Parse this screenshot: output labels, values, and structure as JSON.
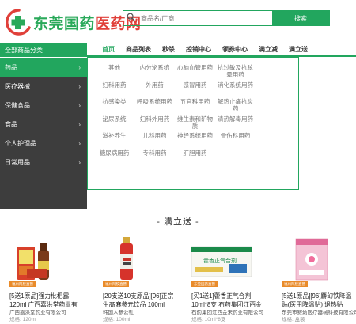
{
  "logo": {
    "part1": "东莞国药",
    "part2": "医药网",
    "colors": {
      "green": "#2aa95a",
      "red": "#e0403a"
    }
  },
  "search": {
    "placeholder": "商品名/厂商",
    "button": "搜索"
  },
  "navbar": {
    "all_categories": "全部商品分类",
    "items": [
      "首页",
      "商品列表",
      "秒杀",
      "控销中心",
      "领券中心",
      "满立减",
      "满立送"
    ]
  },
  "sidebar": {
    "items": [
      {
        "label": "药品",
        "arrow": "›"
      },
      {
        "label": "医疗器械",
        "arrow": "›"
      },
      {
        "label": "保健食品",
        "arrow": "›"
      },
      {
        "label": "食品",
        "arrow": "›"
      },
      {
        "label": "个人护理品",
        "arrow": "›"
      },
      {
        "label": "日常用品",
        "arrow": "›"
      }
    ]
  },
  "panel": {
    "cells": [
      "其他",
      "内分泌系统",
      "心脑血管用药",
      "抗过敏及抗眩晕用药",
      "",
      "妇科用药",
      "外用药",
      "感冒用药",
      "消化系统用药",
      "",
      "抗感染类",
      "呼吸系统用药",
      "五官科用药",
      "解热止痛抗炎药",
      "",
      "泌尿系统",
      "妇科外用药",
      "维生素和矿物质",
      "清热解毒用药",
      "",
      "滋补养生",
      "儿科用药",
      "神经系统用药",
      "骨伤科用药",
      "",
      "糖尿病用药",
      "专科用药",
      "肝胆用药",
      "",
      ""
    ]
  },
  "section": {
    "title": "- 满立送 -"
  },
  "products": [
    {
      "tag": "福州阿胶直营",
      "title": "[5送1原品]强力枇杷露 120ml 广西嘉洪堂药业有",
      "sub": "广西嘉洪堂药业有限公司",
      "sub2": "规格: 120ml"
    },
    {
      "tag": "福州阿胶直营",
      "title": "[20支送10支原品][96]正宗生髙麻参元饮品 100ml",
      "sub": "韩国人参公社",
      "sub2": "规格: 100ml"
    },
    {
      "tag": "东莞国药直营",
      "title": "[买1送1]藿香正气合剂 10ml*8支 石药集团江西金",
      "sub": "石药集团江西金来药业有限公司",
      "sub2": "规格: 10ml*8支"
    },
    {
      "tag": "福州阿胶直营",
      "title": "[5送1原品][96]麝幻铁降温贴(医用降温贴) 退热贴",
      "sub": "东莞市赛幼医疗器械科技有限公司",
      "sub2": "规格: 盒装"
    }
  ],
  "colors": {
    "accent": "#22a65e",
    "sidebar_bg": "#3d3d3d",
    "tag": "#e98b2a"
  }
}
